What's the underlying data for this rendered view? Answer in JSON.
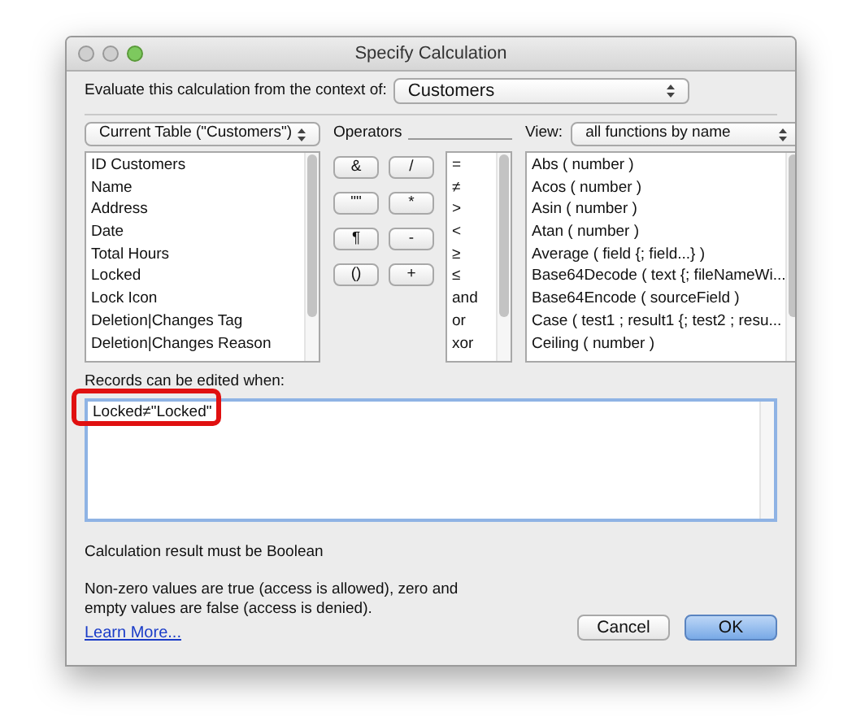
{
  "window": {
    "title": "Specify Calculation"
  },
  "context": {
    "label": "Evaluate this calculation from the context of:",
    "value": "Customers"
  },
  "table_menu": {
    "value": "Current Table (\"Customers\")"
  },
  "fields": [
    "ID Customers",
    "Name",
    "Address",
    "Date",
    "Total Hours",
    "Locked",
    "Lock Icon",
    "Deletion|Changes Tag",
    "Deletion|Changes Reason"
  ],
  "operators": {
    "label": "Operators",
    "buttons": [
      "&",
      "/",
      "\"\"",
      "*",
      "¶",
      "-",
      "()",
      "+"
    ],
    "list": [
      "=",
      "≠",
      ">",
      "<",
      "≥",
      "≤",
      "and",
      "or",
      "xor"
    ]
  },
  "view": {
    "label": "View:",
    "value": "all functions by name"
  },
  "functions": [
    "Abs ( number )",
    "Acos ( number )",
    "Asin ( number )",
    "Atan ( number )",
    "Average ( field {; field...} )",
    "Base64Decode ( text {; fileNameWi...",
    "Base64Encode ( sourceField )",
    "Case ( test1 ; result1 {; test2 ; resu...",
    "Ceiling ( number )"
  ],
  "formula": {
    "label": "Records can be edited when:",
    "value": "Locked≠\"Locked\"",
    "highlighted": true
  },
  "result_note": "Calculation result must be Boolean",
  "help_text": "Non-zero values are true (access is allowed), zero and empty values are false (access is denied).",
  "learn_more": "Learn More...",
  "buttons": [
    {
      "label": "Cancel",
      "default": false
    },
    {
      "label": "OK",
      "default": true
    }
  ]
}
